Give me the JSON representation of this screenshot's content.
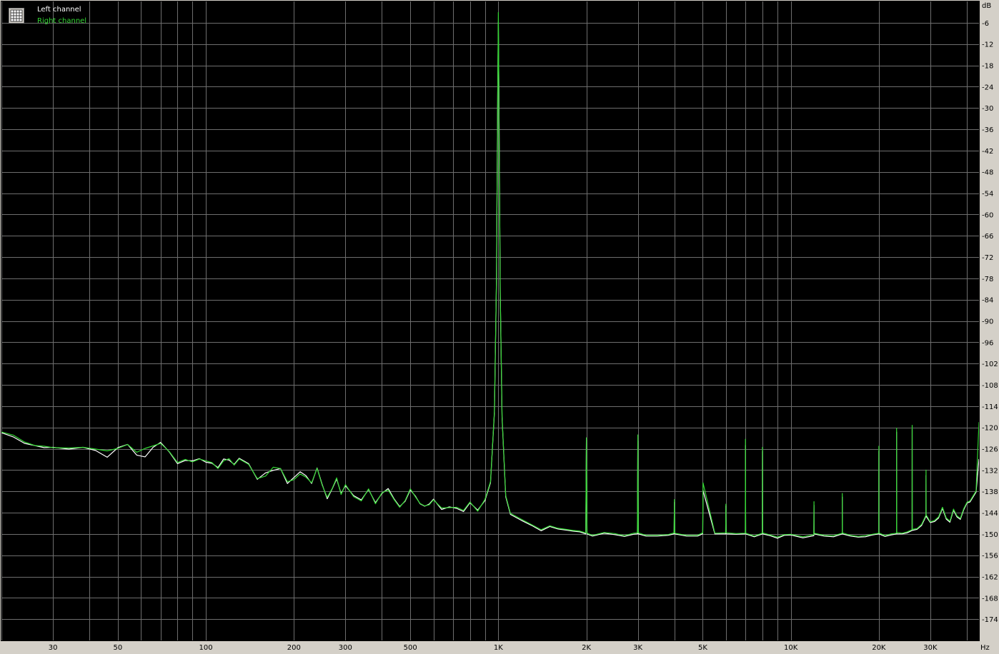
{
  "chart_data": {
    "type": "line",
    "title": "",
    "xlabel": "",
    "ylabel": "",
    "x_unit": "Hz",
    "y_unit": "dB",
    "x_scale": "log",
    "xlim": [
      20,
      44000
    ],
    "ylim": [
      -180,
      0
    ],
    "grid": true,
    "legend_position": "top-left",
    "background_color": "#000000",
    "grid_color": "#6e6e6e",
    "x_ticks": [
      {
        "value": 30,
        "label": "30"
      },
      {
        "value": 50,
        "label": "50"
      },
      {
        "value": 100,
        "label": "100"
      },
      {
        "value": 200,
        "label": "200"
      },
      {
        "value": 300,
        "label": "300"
      },
      {
        "value": 500,
        "label": "500"
      },
      {
        "value": 1000,
        "label": "1K"
      },
      {
        "value": 2000,
        "label": "2K"
      },
      {
        "value": 3000,
        "label": "3K"
      },
      {
        "value": 5000,
        "label": "5K"
      },
      {
        "value": 10000,
        "label": "10K"
      },
      {
        "value": 20000,
        "label": "20K"
      },
      {
        "value": 30000,
        "label": "30K"
      }
    ],
    "y_ticks": [
      -6,
      -12,
      -18,
      -24,
      -30,
      -36,
      -42,
      -48,
      -54,
      -60,
      -66,
      -72,
      -78,
      -84,
      -90,
      -96,
      -102,
      -108,
      -114,
      -120,
      -126,
      -132,
      -138,
      -144,
      -150,
      -156,
      -162,
      -168,
      -174
    ],
    "series": [
      {
        "name": "Left channel",
        "color": "#ffffff",
        "x": [
          20,
          22,
          24,
          26,
          28,
          30,
          34,
          38,
          42,
          46,
          50,
          54,
          58,
          62,
          66,
          70,
          75,
          80,
          85,
          90,
          95,
          100,
          105,
          110,
          115,
          120,
          125,
          130,
          140,
          150,
          160,
          170,
          180,
          190,
          200,
          210,
          220,
          230,
          240,
          250,
          260,
          270,
          280,
          290,
          300,
          320,
          340,
          360,
          380,
          400,
          420,
          440,
          460,
          480,
          500,
          520,
          540,
          560,
          580,
          600,
          640,
          680,
          720,
          760,
          800,
          850,
          900,
          940,
          970,
          985,
          995,
          1000,
          1005,
          1015,
          1030,
          1060,
          1100,
          1200,
          1300,
          1400,
          1500,
          1600,
          1700,
          1800,
          1900,
          1990,
          2000,
          2010,
          2100,
          2300,
          2500,
          2700,
          2900,
          2990,
          3000,
          3010,
          3200,
          3500,
          3800,
          3990,
          4000,
          4010,
          4400,
          4800,
          4990,
          5000,
          5010,
          5500,
          5990,
          6000,
          6010,
          6500,
          6990,
          7000,
          7010,
          7500,
          7990,
          8000,
          8010,
          8500,
          9000,
          9500,
          10000,
          11000,
          11990,
          12000,
          12010,
          13000,
          14000,
          14990,
          15000,
          15010,
          16000,
          17000,
          18000,
          19000,
          19990,
          20000,
          20010,
          21000,
          22000,
          22990,
          23000,
          23010,
          24000,
          25000,
          25990,
          26000,
          26010,
          27000,
          28000,
          28990,
          29000,
          29010,
          30000,
          31000,
          32000,
          33000,
          34000,
          35000,
          36000,
          37000,
          38000,
          39000,
          40000,
          41000,
          42000,
          43000,
          44000
        ],
        "y": [
          -121.5,
          -122.7,
          -124.5,
          -125.1,
          -125.7,
          -125.6,
          -126.1,
          -125.6,
          -126.5,
          -128.4,
          -125.7,
          -124.8,
          -127.8,
          -128.3,
          -125.6,
          -124.2,
          -126.9,
          -130.2,
          -129.3,
          -129.4,
          -128.8,
          -129.8,
          -130.1,
          -131.3,
          -128.9,
          -129.2,
          -130.4,
          -128.7,
          -130.2,
          -134.6,
          -132.8,
          -132.1,
          -131.6,
          -135.8,
          -134.1,
          -132.5,
          -133.6,
          -135.8,
          -131.4,
          -136.1,
          -140.1,
          -137.4,
          -134.5,
          -138.6,
          -136.4,
          -139.2,
          -140.4,
          -137.5,
          -141.2,
          -138.6,
          -137.2,
          -140.1,
          -142.3,
          -140.8,
          -137.6,
          -139.3,
          -141.5,
          -142.2,
          -141.6,
          -140.2,
          -143.1,
          -142.4,
          -142.8,
          -143.7,
          -141.2,
          -143.3,
          -140.6,
          -135.6,
          -115.8,
          -79.4,
          -26.1,
          -5.8,
          -26.5,
          -81.6,
          -117.3,
          -139.5,
          -144.5,
          -146.2,
          -147.6,
          -149.1,
          -147.9,
          -148.6,
          -148.9,
          -149.2,
          -149.4,
          -150.0,
          -123.5,
          -150.0,
          -150.6,
          -149.8,
          -150.2,
          -150.7,
          -150.1,
          -150.0,
          -123.8,
          -150.0,
          -150.6,
          -150.6,
          -150.4,
          -150.0,
          -141.1,
          -150.0,
          -150.6,
          -150.6,
          -150.0,
          -150.0,
          -137.7,
          -150.0,
          -150.0,
          -142.1,
          -150.0,
          -150.1,
          -150.0,
          -125.1,
          -150.0,
          -150.8,
          -150.0,
          -126.7,
          -150.0,
          -150.5,
          -151.2,
          -150.4,
          -150.3,
          -151.1,
          -150.5,
          -141.9,
          -150.0,
          -150.6,
          -150.8,
          -150.0,
          -139.6,
          -150.0,
          -150.6,
          -150.9,
          -150.8,
          -150.3,
          -150.0,
          -126.7,
          -150.0,
          -150.7,
          -150.3,
          -150.0,
          -121.3,
          -150.0,
          -150.0,
          -149.7,
          -149.0,
          -120.5,
          -149.0,
          -148.7,
          -147.6,
          -145.0,
          -133.5,
          -145.0,
          -146.8,
          -146.5,
          -145.5,
          -142.8,
          -145.8,
          -146.7,
          -143.3,
          -145.2,
          -145.9,
          -143.2,
          -141.3,
          -141.0,
          -139.6,
          -138.2,
          -128.9
        ]
      },
      {
        "name": "Right channel",
        "color": "#33d633",
        "x": [
          20,
          22,
          24,
          26,
          28,
          30,
          34,
          38,
          42,
          46,
          50,
          54,
          58,
          62,
          66,
          70,
          75,
          80,
          85,
          90,
          95,
          100,
          105,
          110,
          115,
          120,
          125,
          130,
          140,
          150,
          160,
          170,
          180,
          190,
          200,
          210,
          220,
          230,
          240,
          250,
          260,
          270,
          280,
          290,
          300,
          320,
          340,
          360,
          380,
          400,
          420,
          440,
          460,
          480,
          500,
          520,
          540,
          560,
          580,
          600,
          640,
          680,
          720,
          760,
          800,
          850,
          900,
          940,
          970,
          985,
          995,
          1000,
          1005,
          1015,
          1030,
          1060,
          1100,
          1200,
          1300,
          1400,
          1500,
          1600,
          1700,
          1800,
          1900,
          1990,
          2000,
          2010,
          2100,
          2300,
          2500,
          2700,
          2900,
          2990,
          3000,
          3010,
          3200,
          3500,
          3800,
          3990,
          4000,
          4010,
          4400,
          4800,
          4990,
          5000,
          5010,
          5500,
          5990,
          6000,
          6010,
          6500,
          6990,
          7000,
          7010,
          7500,
          7990,
          8000,
          8010,
          8500,
          9000,
          9500,
          10000,
          11000,
          11990,
          12000,
          12010,
          13000,
          14000,
          14990,
          15000,
          15010,
          16000,
          17000,
          18000,
          19000,
          19990,
          20000,
          20010,
          21000,
          22000,
          22990,
          23000,
          23010,
          24000,
          25000,
          25990,
          26000,
          26010,
          27000,
          28000,
          28990,
          29000,
          29010,
          30000,
          31000,
          32000,
          33000,
          34000,
          35000,
          36000,
          37000,
          38000,
          39000,
          40000,
          41000,
          42000,
          43000,
          44000
        ],
        "y": [
          -121.3,
          -122.2,
          -124.1,
          -125.1,
          -125.3,
          -125.7,
          -125.8,
          -125.6,
          -126.1,
          -126.6,
          -125.9,
          -124.8,
          -127.0,
          -125.9,
          -125.2,
          -124.5,
          -126.8,
          -129.9,
          -129.0,
          -129.7,
          -128.9,
          -129.4,
          -129.9,
          -131.6,
          -129.4,
          -128.8,
          -130.6,
          -128.9,
          -130.4,
          -134.4,
          -133.7,
          -131.2,
          -131.6,
          -135.3,
          -134.7,
          -133.1,
          -134.0,
          -135.6,
          -131.5,
          -136.3,
          -139.7,
          -137.3,
          -134.2,
          -138.9,
          -136.1,
          -139.5,
          -140.7,
          -137.3,
          -141.5,
          -138.4,
          -137.6,
          -140.3,
          -142.5,
          -140.6,
          -137.3,
          -139.5,
          -141.4,
          -142.1,
          -141.8,
          -140.4,
          -142.7,
          -142.6,
          -142.5,
          -143.4,
          -141.0,
          -143.6,
          -140.3,
          -135.3,
          -115.4,
          -79.0,
          -25.9,
          -3.1,
          -26.3,
          -81.2,
          -116.9,
          -139.2,
          -144.2,
          -145.9,
          -147.4,
          -148.8,
          -147.7,
          -148.4,
          -148.7,
          -149.0,
          -149.2,
          -149.7,
          -122.9,
          -149.8,
          -150.4,
          -149.6,
          -149.9,
          -150.5,
          -149.8,
          -149.7,
          -122.1,
          -149.7,
          -150.4,
          -150.4,
          -150.2,
          -149.7,
          -140.3,
          -149.8,
          -150.4,
          -150.4,
          -149.7,
          -149.8,
          -135.6,
          -149.8,
          -149.7,
          -141.6,
          -149.7,
          -149.9,
          -149.8,
          -123.3,
          -149.8,
          -150.6,
          -149.8,
          -125.6,
          -149.7,
          -150.3,
          -150.9,
          -150.2,
          -150.1,
          -150.8,
          -150.2,
          -140.9,
          -149.8,
          -150.4,
          -150.5,
          -149.8,
          -138.6,
          -149.7,
          -150.4,
          -150.7,
          -150.5,
          -150.1,
          -149.8,
          -125.3,
          -149.7,
          -150.5,
          -150.0,
          -149.8,
          -120.2,
          -149.6,
          -149.8,
          -149.4,
          -148.8,
          -119.4,
          -148.7,
          -148.5,
          -147.3,
          -144.7,
          -132.0,
          -144.6,
          -146.6,
          -146.2,
          -145.2,
          -142.5,
          -145.5,
          -146.4,
          -143.0,
          -144.9,
          -145.6,
          -142.9,
          -141.1,
          -140.7,
          -139.3,
          -137.9,
          -118.5
        ]
      }
    ]
  }
}
